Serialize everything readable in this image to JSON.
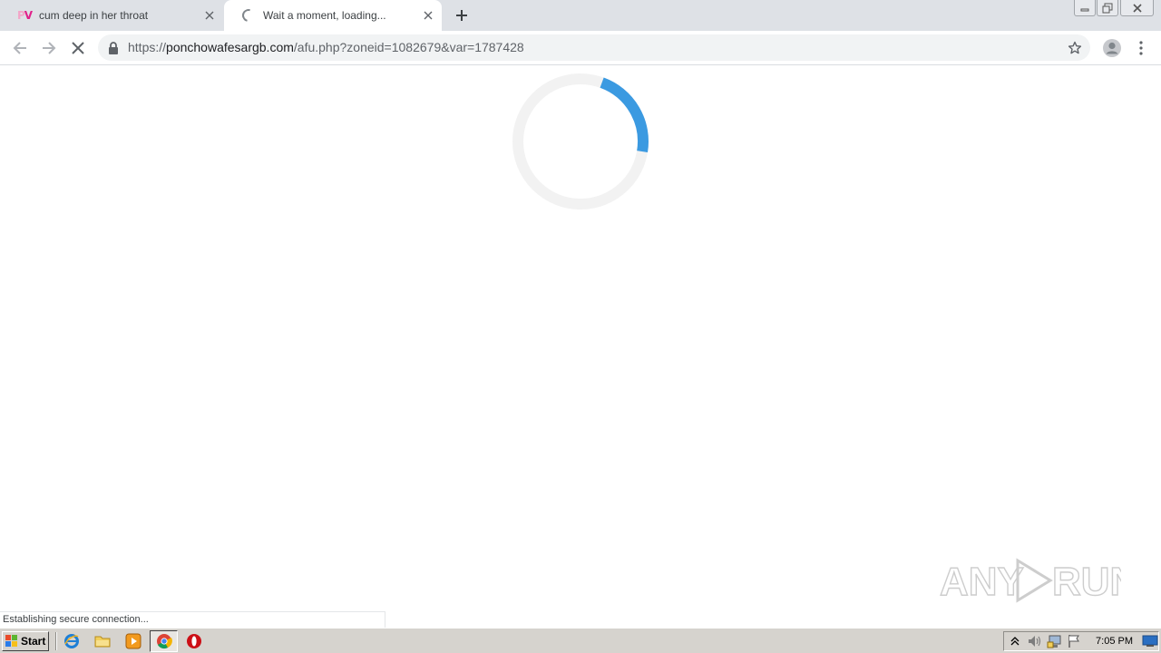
{
  "tabs": [
    {
      "title": "cum deep in her throat",
      "favicon": "pv-logo-icon",
      "favicon_text_p": "P",
      "favicon_text_v": "V",
      "active": false
    },
    {
      "title": "Wait a moment, loading...",
      "favicon": "loading-spinner-icon",
      "active": true
    }
  ],
  "new_tab_icon": "plus-icon",
  "window_controls": [
    "minimize-icon",
    "restore-icon",
    "close-icon"
  ],
  "toolbar": {
    "back_icon": "arrow-left-icon",
    "forward_icon": "arrow-right-icon",
    "stop_icon": "close-icon",
    "url_scheme": "https://",
    "url_host": "ponchowafesargb.com",
    "url_path": "/afu.php?zoneid=1082679&var=1787428",
    "bookmark_icon": "star-icon",
    "profile_icon": "avatar-icon",
    "menu_icon": "kebab-menu-icon"
  },
  "page": {
    "loader_progress": 0.22,
    "loader_color": "#3b9ae1",
    "loader_track_color": "#f2f2f2",
    "status_text": "Establishing secure connection..."
  },
  "watermark": {
    "left": "ANY",
    "right": "RUN"
  },
  "taskbar": {
    "start_label": "Start",
    "quick_launch": [
      "internet-explorer-icon",
      "folder-icon",
      "media-player-icon"
    ],
    "running": [
      "chrome-icon",
      "opera-icon"
    ],
    "tray_icons": [
      "show-hidden-icons-icon",
      "volume-icon",
      "network-icon",
      "action-center-flag-icon"
    ],
    "clock": "7:05 PM",
    "show_desktop_icon": "show-desktop-icon"
  },
  "colors": {
    "tabstrip": "#dee1e6",
    "accent_blue": "#3b9ae1",
    "taskbar": "#d6d3ce"
  }
}
